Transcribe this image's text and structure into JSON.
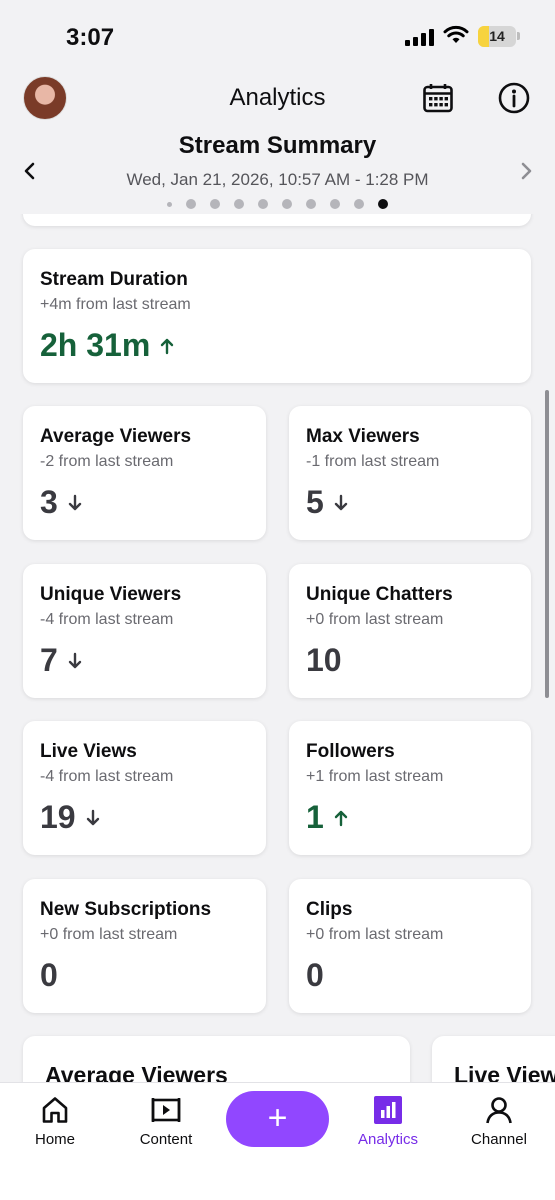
{
  "status_bar": {
    "time": "3:07",
    "battery": "14"
  },
  "header": {
    "title": "Analytics"
  },
  "summary": {
    "title": "Stream Summary",
    "date": "Wed, Jan 21, 2026, 10:57 AM - 1:28 PM",
    "page_dots": 10,
    "active_dot": 10
  },
  "stats": [
    {
      "label": "Stream Duration",
      "delta": "+4m from last stream",
      "value": "2h 31m",
      "trend": "up"
    },
    {
      "label": "Average Viewers",
      "delta": "-2 from last stream",
      "value": "3",
      "trend": "down"
    },
    {
      "label": "Max Viewers",
      "delta": "-1 from last stream",
      "value": "5",
      "trend": "down"
    },
    {
      "label": "Unique Viewers",
      "delta": "-4 from last stream",
      "value": "7",
      "trend": "down"
    },
    {
      "label": "Unique Chatters",
      "delta": "+0 from last stream",
      "value": "10",
      "trend": "none"
    },
    {
      "label": "Live Views",
      "delta": "-4 from last stream",
      "value": "19",
      "trend": "down"
    },
    {
      "label": "Followers",
      "delta": "+1 from last stream",
      "value": "1",
      "trend": "up"
    },
    {
      "label": "New Subscriptions",
      "delta": "+0 from last stream",
      "value": "0",
      "trend": "none"
    },
    {
      "label": "Clips",
      "delta": "+0 from last stream",
      "value": "0",
      "trend": "none"
    }
  ],
  "charts_preview": [
    "Average Viewers",
    "Live Views"
  ],
  "tabs": [
    {
      "label": "Home",
      "icon": "home-icon"
    },
    {
      "label": "Content",
      "icon": "content-icon"
    },
    {
      "label": "+",
      "icon": "plus-icon"
    },
    {
      "label": "Analytics",
      "icon": "analytics-icon",
      "active": true
    },
    {
      "label": "Channel",
      "icon": "channel-icon"
    }
  ],
  "colors": {
    "accent": "#9147ff",
    "active_tab": "#772ce8",
    "up": "#16613a",
    "down": "#3a3a40"
  }
}
